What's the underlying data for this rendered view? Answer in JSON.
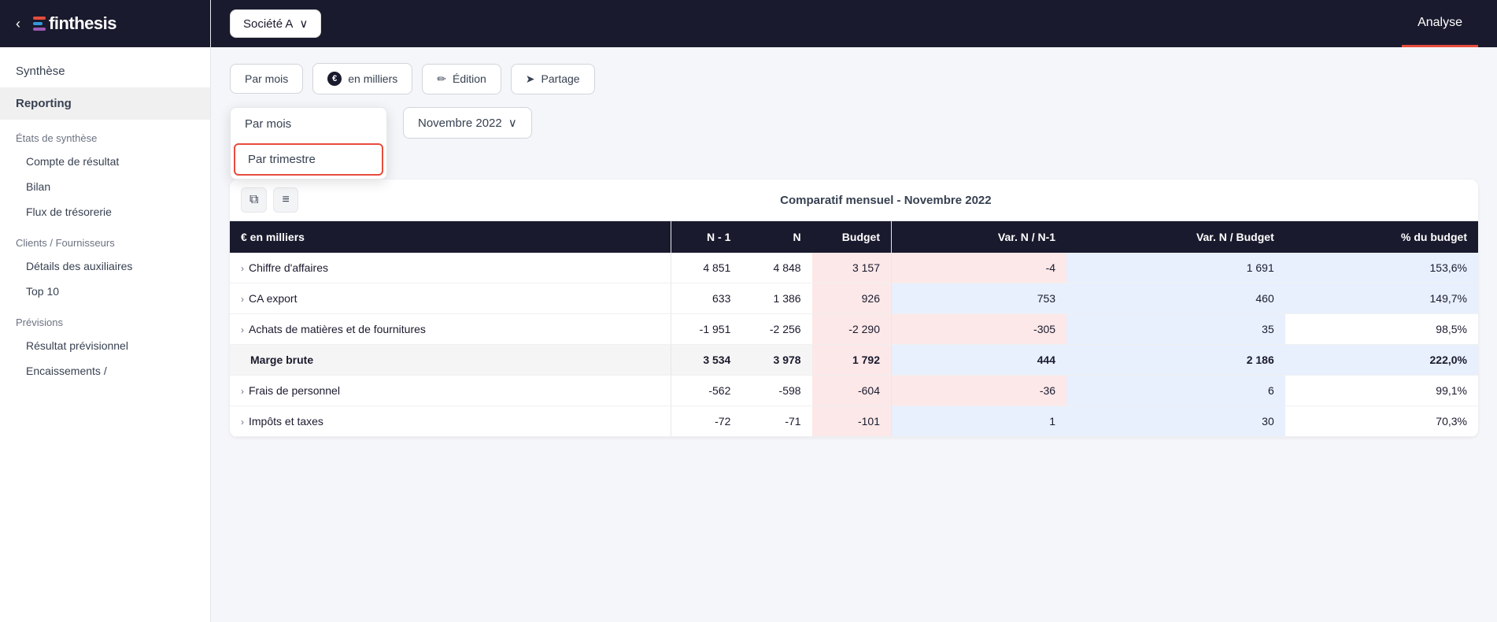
{
  "app": {
    "name": "finthesis",
    "back_label": "‹"
  },
  "topbar": {
    "company": "Société A",
    "company_chevron": "∨",
    "tabs": [
      {
        "id": "analyse",
        "label": "Analyse",
        "active": true
      }
    ]
  },
  "toolbar": {
    "btn_par_mois": "Par mois",
    "btn_en_milliers": "en milliers",
    "btn_edition": "Édition",
    "btn_partage": "Partage",
    "edition_icon": "✏",
    "partage_icon": "➤",
    "milliers_icon": "©"
  },
  "dropdown": {
    "items": [
      {
        "id": "par_mois",
        "label": "Par mois",
        "highlighted": false
      },
      {
        "id": "par_trimestre",
        "label": "Par trimestre",
        "highlighted": true
      }
    ]
  },
  "date_selector": {
    "label": "Novembre 2022",
    "chevron": "∨"
  },
  "sidebar": {
    "synthese": "Synthèse",
    "reporting": "Reporting",
    "etats_synthese": "États de synthèse",
    "sub_items_etats": [
      "Compte de résultat",
      "Bilan",
      "Flux de trésorerie"
    ],
    "clients_fournisseurs": "Clients / Fournisseurs",
    "sub_items_clients": [
      "Détails des auxiliaires",
      "Top 10"
    ],
    "previsions": "Prévisions",
    "sub_items_previsions": [
      "Résultat prévisionnel",
      "Encaissements /"
    ]
  },
  "table": {
    "comparatif_title": "Comparatif mensuel - Novembre 2022",
    "header_left": "€ en milliers",
    "headers_mid": [
      "N - 1",
      "N",
      "Budget"
    ],
    "headers_right": [
      "Var. N / N-1",
      "Var. N / Budget",
      "% du budget"
    ],
    "rows": [
      {
        "label": "Chiffre d'affaires",
        "expandable": true,
        "bold": false,
        "n_minus_1": "4 851",
        "n": "4 848",
        "budget": "3 157",
        "var_n_nm1": "-4",
        "var_n_budget": "1 691",
        "pct_budget": "153,6%",
        "var_n_nm1_type": "negative",
        "var_n_budget_type": "positive",
        "pct_type": "positive"
      },
      {
        "label": "CA export",
        "expandable": true,
        "bold": false,
        "n_minus_1": "633",
        "n": "1 386",
        "budget": "926",
        "var_n_nm1": "753",
        "var_n_budget": "460",
        "pct_budget": "149,7%",
        "var_n_nm1_type": "positive",
        "var_n_budget_type": "positive",
        "pct_type": "positive"
      },
      {
        "label": "Achats de matières et de fournitures",
        "expandable": true,
        "bold": false,
        "n_minus_1": "-1 951",
        "n": "-2 256",
        "budget": "-2 290",
        "var_n_nm1": "-305",
        "var_n_budget": "35",
        "pct_budget": "98,5%",
        "var_n_nm1_type": "negative",
        "var_n_budget_type": "positive",
        "pct_type": "neutral"
      },
      {
        "label": "Marge brute",
        "expandable": false,
        "bold": true,
        "n_minus_1": "3 534",
        "n": "3 978",
        "budget": "1 792",
        "var_n_nm1": "444",
        "var_n_budget": "2 186",
        "pct_budget": "222,0%",
        "var_n_nm1_type": "positive",
        "var_n_budget_type": "positive",
        "pct_type": "positive"
      },
      {
        "label": "Frais de personnel",
        "expandable": true,
        "bold": false,
        "n_minus_1": "-562",
        "n": "-598",
        "budget": "-604",
        "var_n_nm1": "-36",
        "var_n_budget": "6",
        "pct_budget": "99,1%",
        "var_n_nm1_type": "negative",
        "var_n_budget_type": "positive",
        "pct_type": "neutral"
      },
      {
        "label": "Impôts et taxes",
        "expandable": true,
        "bold": false,
        "n_minus_1": "-72",
        "n": "-71",
        "budget": "-101",
        "var_n_nm1": "1",
        "var_n_budget": "30",
        "pct_budget": "70,3%",
        "var_n_nm1_type": "positive",
        "var_n_budget_type": "positive",
        "pct_type": "neutral"
      }
    ]
  }
}
